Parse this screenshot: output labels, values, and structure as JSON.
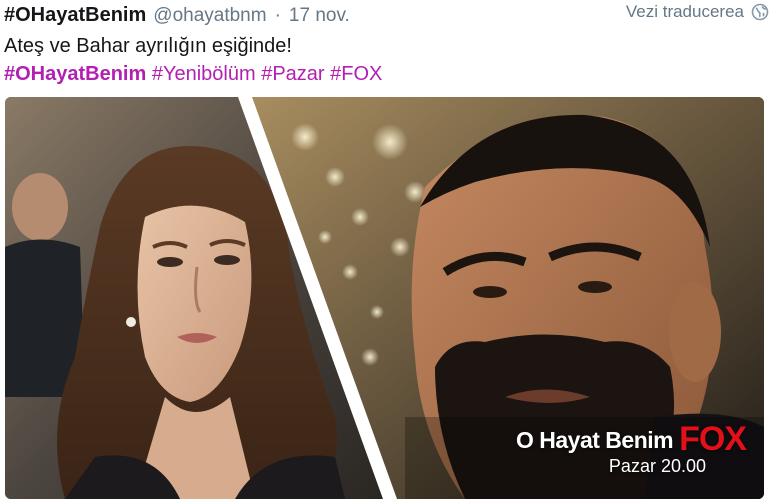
{
  "tweet": {
    "display_name": "#OHayatBenim",
    "handle": "@ohayatbnm",
    "separator": "·",
    "time": "17 nov.",
    "translate_label": "Vezi traducerea",
    "text": "Ateş ve Bahar ayrılığın eşiğinde!",
    "hashtags": [
      "#OHayatBenim",
      "#Yenibölüm",
      "#Pazar",
      "#FOX"
    ]
  },
  "media": {
    "show_title": "O Hayat Benim",
    "network_logo": "FOX",
    "schedule": "Pazar 20.00"
  },
  "colors": {
    "hashtag": "#b31fb3",
    "secondary_text": "#657786",
    "primary_text": "#14171a",
    "fox_red": "#e3101a"
  },
  "icons": {
    "globe": "globe-icon"
  }
}
